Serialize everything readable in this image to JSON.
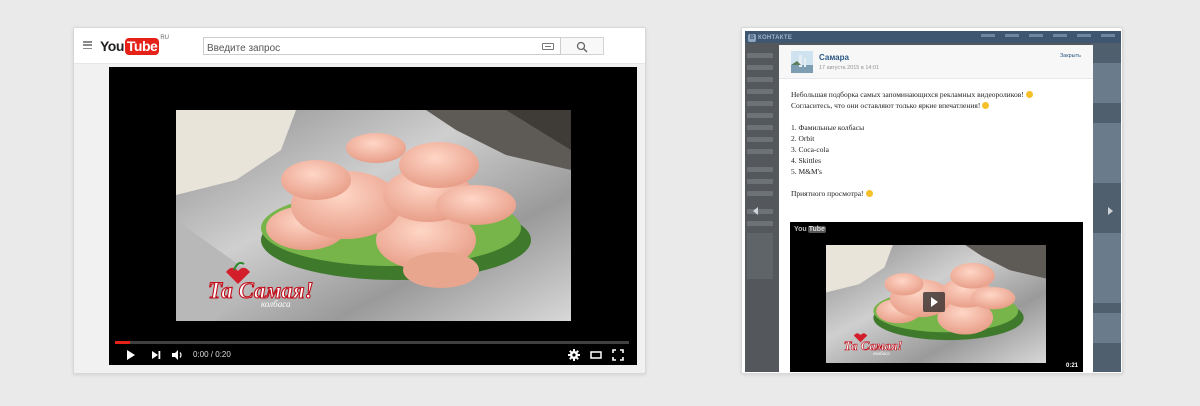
{
  "youtube": {
    "logo_you": "You",
    "logo_tube": "Tube",
    "logo_region": "RU",
    "search": {
      "placeholder": "Введите запрос"
    },
    "video": {
      "brand_main": "Та Самая!",
      "brand_sub": "колбаса"
    },
    "player": {
      "time": "0:00 / 0:20",
      "progress_fraction": 0.03
    },
    "icons": [
      "hamburger-icon",
      "keyboard-icon",
      "search-icon",
      "play-icon",
      "next-icon",
      "volume-icon",
      "settings-icon",
      "theater-icon",
      "fullscreen-icon"
    ],
    "colors": {
      "accent": "#e62117",
      "player_bg": "#000000"
    }
  },
  "vk": {
    "logo_letter": "В",
    "logo_text": "КОНТАКТЕ",
    "post": {
      "author": "Самара",
      "date": "17 августа 2015 в 14:01",
      "close_label": "Закрыть",
      "lines": [
        "Небольшая подборка самых запоминающихся рекламных видеороликов!",
        "Согласитесь, что они оставляют только яркие впечатления!",
        "1. Фамильные колбасы",
        "2. Orbit",
        "3. Coca-cola",
        "4. Skittles",
        "5. M&M's",
        "Приятного просмотра!"
      ],
      "video": {
        "badge_you": "You",
        "badge_tube": "Tube",
        "brand_main": "Та Самая!",
        "brand_sub": "колбаса",
        "duration": "0:21"
      }
    },
    "colors": {
      "link": "#2a5885",
      "topbar": "#3e5670"
    }
  }
}
